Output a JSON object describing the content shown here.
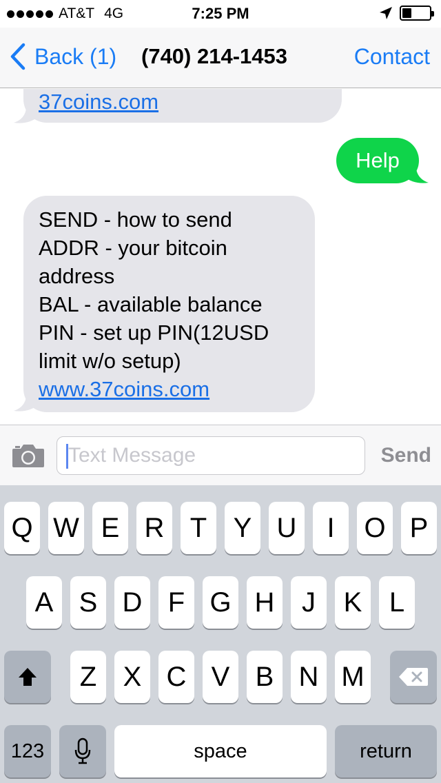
{
  "status_bar": {
    "carrier": "AT&T",
    "network": "4G",
    "time": "7:25 PM",
    "battery_level": 0.35,
    "location_icon": "location-arrow-icon"
  },
  "nav": {
    "back_label": "Back (1)",
    "title": "(740) 214-1453",
    "contact_label": "Contact"
  },
  "messages": [
    {
      "direction": "incoming",
      "link": "37coins.com"
    },
    {
      "direction": "outgoing",
      "text": "Help"
    },
    {
      "direction": "incoming",
      "lines": [
        "SEND - how to send",
        "ADDR - your bitcoin",
        "address",
        "BAL - available balance",
        "PIN - set up PIN(12USD",
        "limit w/o setup)"
      ],
      "link": "www.37coins.com"
    }
  ],
  "input": {
    "placeholder": "Text Message",
    "send_label": "Send"
  },
  "keyboard": {
    "row1": [
      "Q",
      "W",
      "E",
      "R",
      "T",
      "Y",
      "U",
      "I",
      "O",
      "P"
    ],
    "row2": [
      "A",
      "S",
      "D",
      "F",
      "G",
      "H",
      "J",
      "K",
      "L"
    ],
    "row3": [
      "Z",
      "X",
      "C",
      "V",
      "B",
      "N",
      "M"
    ],
    "numbers_label": "123",
    "space_label": "space",
    "return_label": "return"
  },
  "colors": {
    "accent": "#1a7cf5",
    "outgoing_bubble": "#0fd44a",
    "incoming_bubble": "#e5e5ea"
  }
}
